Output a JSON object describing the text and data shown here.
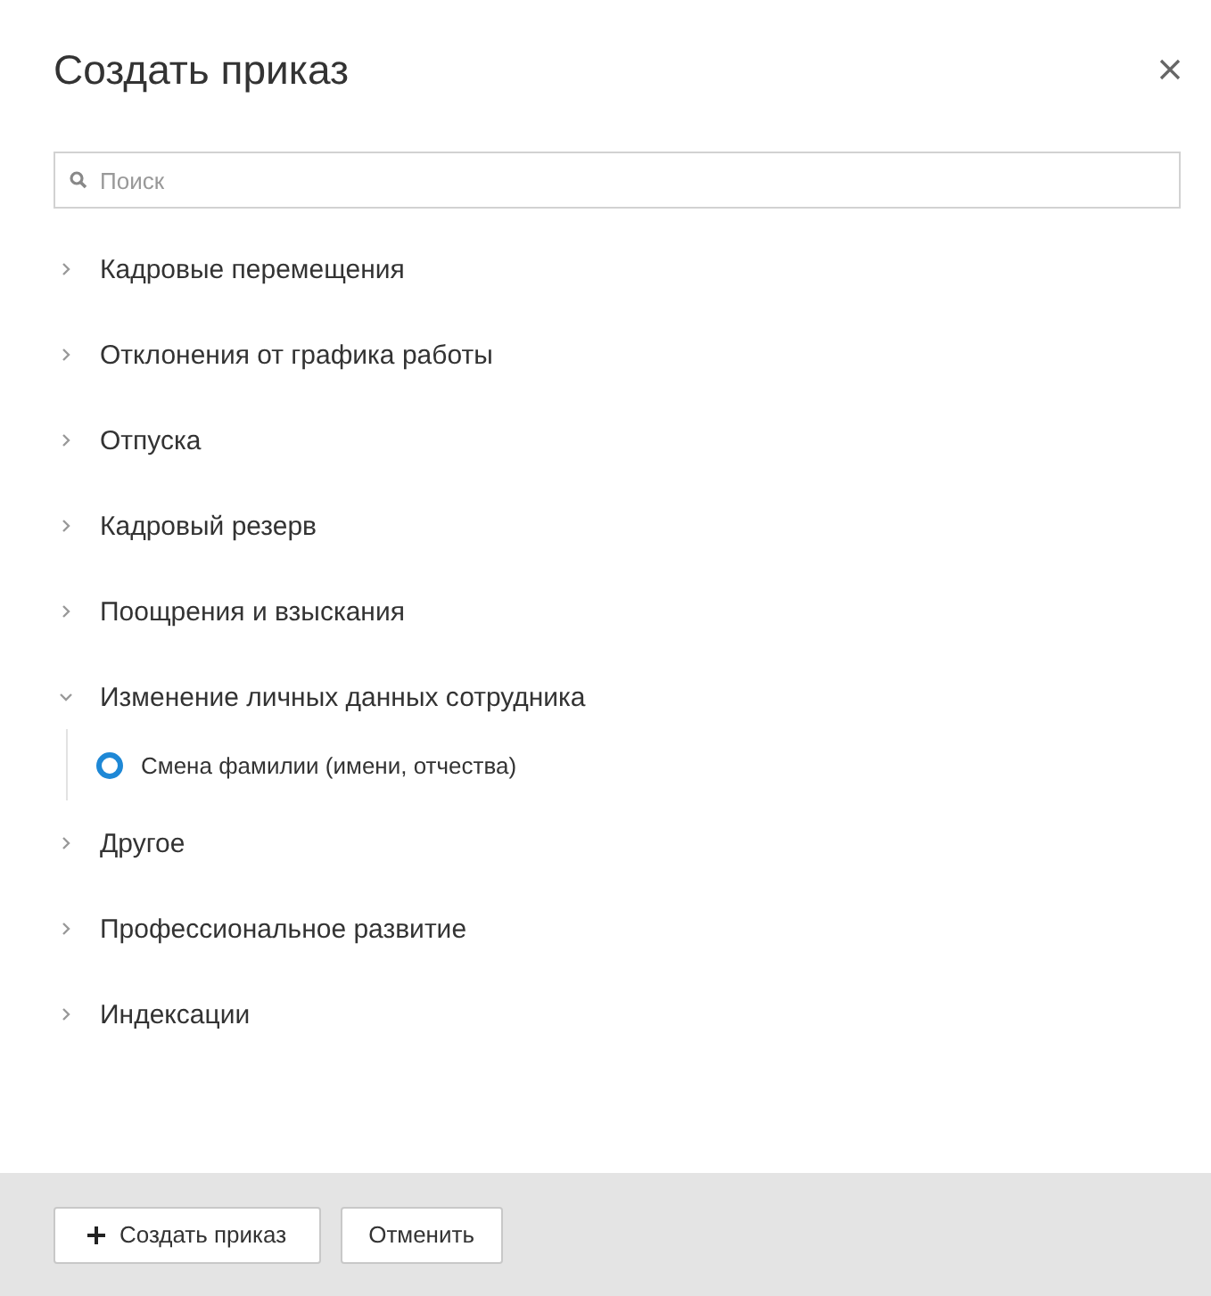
{
  "dialog": {
    "title": "Создать приказ"
  },
  "search": {
    "placeholder": "Поиск"
  },
  "groups": [
    {
      "label": "Кадровые перемещения",
      "expanded": false
    },
    {
      "label": "Отклонения от графика работы",
      "expanded": false
    },
    {
      "label": "Отпуска",
      "expanded": false
    },
    {
      "label": "Кадровый резерв",
      "expanded": false
    },
    {
      "label": "Поощрения и взыскания",
      "expanded": false
    },
    {
      "label": "Изменение личных данных сотрудника",
      "expanded": true,
      "children": [
        {
          "label": "Смена фамилии (имени, отчества)",
          "selected": true
        }
      ]
    },
    {
      "label": "Другое",
      "expanded": false
    },
    {
      "label": "Профессиональное развитие",
      "expanded": false
    },
    {
      "label": "Индексации",
      "expanded": false
    }
  ],
  "buttons": [
    {
      "label": "Создать приказ",
      "kind": "create"
    },
    {
      "label": "Отменить",
      "kind": "cancel"
    }
  ]
}
